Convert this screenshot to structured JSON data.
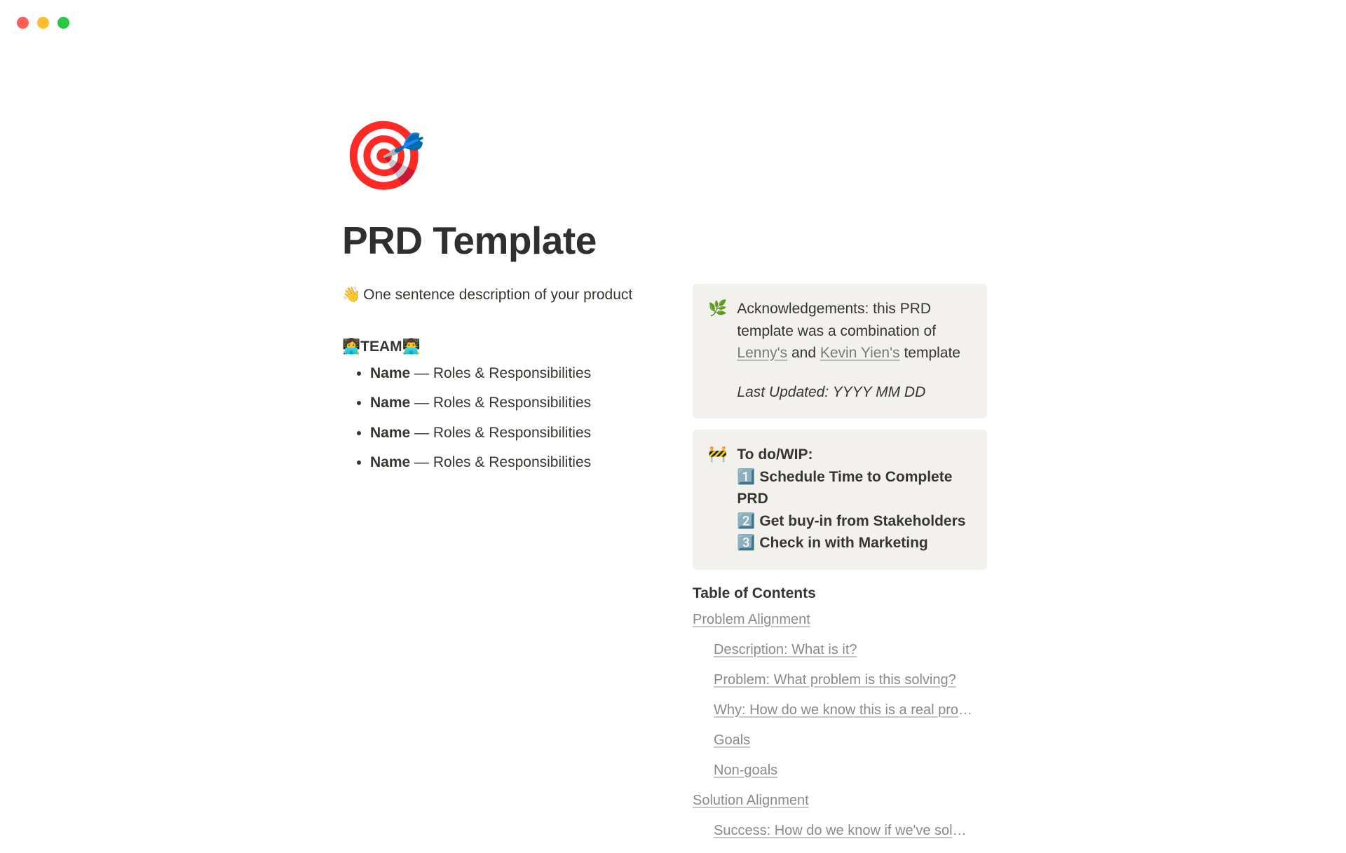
{
  "window": {
    "traffic_lights": [
      "close",
      "minimize",
      "zoom"
    ]
  },
  "page": {
    "icon": "🎯",
    "title": "PRD Template"
  },
  "intro": {
    "emoji": "👋",
    "text": "One sentence description of your product"
  },
  "team": {
    "heading_prefix_emoji": "👩‍💻",
    "heading_label": "TEAM",
    "heading_suffix_emoji": "👨‍💻",
    "members": [
      {
        "name": "Name",
        "role": " — Roles & Responsibilities"
      },
      {
        "name": "Name",
        "role": " — Roles & Responsibilities"
      },
      {
        "name": "Name",
        "role": " — Roles & Responsibilities"
      },
      {
        "name": "Name",
        "role": " — Roles & Responsibilities"
      }
    ]
  },
  "ack": {
    "emoji": "🌿",
    "text_1": "Acknowledgements: this PRD template was a combination of ",
    "link_1": "Lenny's",
    "text_2": " and ",
    "link_2": "Kevin Yien's",
    "text_3": " template",
    "last_updated": "Last Updated: YYYY MM DD"
  },
  "todo": {
    "emoji": "🚧",
    "title": "To do/WIP:",
    "items": [
      "1️⃣ Schedule Time to Complete PRD",
      "2️⃣ Get buy-in from Stakeholders",
      "3️⃣ Check in with Marketing"
    ]
  },
  "toc": {
    "heading": "Table of Contents",
    "entries": [
      {
        "level": 1,
        "text": "Problem Alignment"
      },
      {
        "level": 2,
        "text": "Description: What is it?"
      },
      {
        "level": 2,
        "text": "Problem: What problem is this solving?"
      },
      {
        "level": 2,
        "text": "Why: How do we know this is a real problem …"
      },
      {
        "level": 2,
        "text": "Goals"
      },
      {
        "level": 2,
        "text": "Non-goals"
      },
      {
        "level": 1,
        "text": "Solution Alignment"
      },
      {
        "level": 2,
        "text": "Success: How do we know if we've solved thi…"
      }
    ]
  }
}
